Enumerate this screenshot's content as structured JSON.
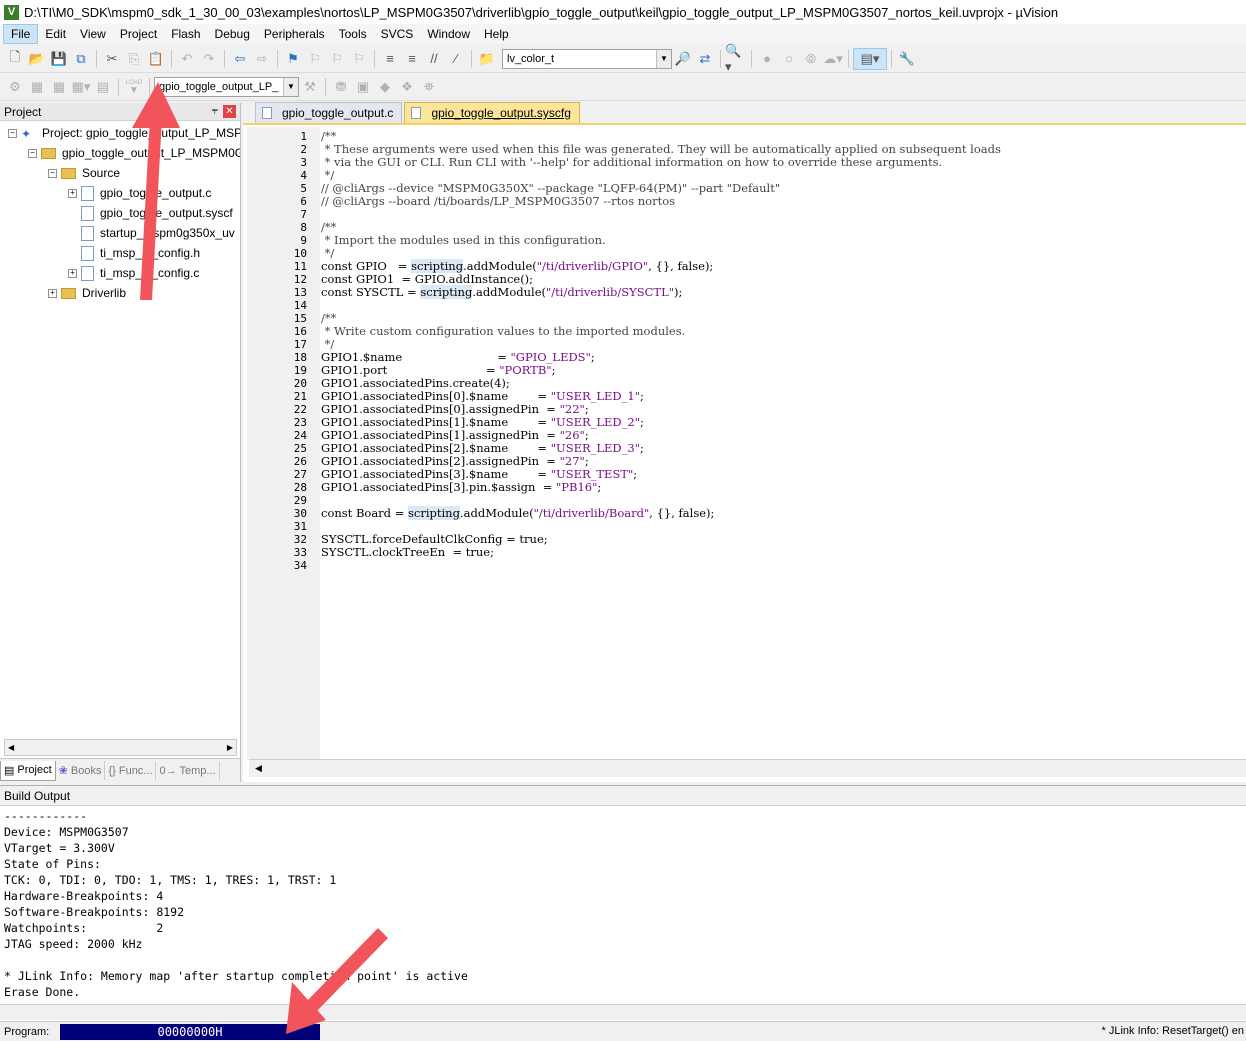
{
  "window": {
    "title": "D:\\TI\\M0_SDK\\mspm0_sdk_1_30_00_03\\examples\\nortos\\LP_MSPM0G3507\\driverlib\\gpio_toggle_output\\keil\\gpio_toggle_output_LP_MSPM0G3507_nortos_keil.uvprojx - µVision"
  },
  "menu": [
    "File",
    "Edit",
    "View",
    "Project",
    "Flash",
    "Debug",
    "Peripherals",
    "Tools",
    "SVCS",
    "Window",
    "Help"
  ],
  "toolbar": {
    "find_combo_value": "lv_color_t",
    "target_combo_value": "gpio_toggle_output_LP_",
    "load_icon_label": "LOAD"
  },
  "project_panel": {
    "title": "Project",
    "tree": [
      {
        "label": "Project: gpio_toggle_output_LP_MSP",
        "icon": "project-icon"
      },
      {
        "label": "gpio_toggle_output_LP_MSPM0G",
        "icon": "target-icon"
      },
      {
        "label": "Source",
        "icon": "folder-icon"
      },
      {
        "label": "gpio_toggle_output.c",
        "icon": "file-icon"
      },
      {
        "label": "gpio_toggle_output.syscf",
        "icon": "file-icon"
      },
      {
        "label": "startup_mspm0g350x_uv",
        "icon": "file-icon"
      },
      {
        "label": "ti_msp_dl_config.h",
        "icon": "file-icon"
      },
      {
        "label": "ti_msp_dl_config.c",
        "icon": "file-icon"
      },
      {
        "label": "Driverlib",
        "icon": "folder-icon"
      }
    ],
    "tabs": [
      "Project",
      "Books",
      "{} Func...",
      "0→ Temp..."
    ]
  },
  "editor": {
    "tabs": [
      {
        "label": "gpio_toggle_output.c",
        "active": false
      },
      {
        "label": "gpio_toggle_output.syscfg",
        "active": true
      }
    ],
    "lines": [
      "/**",
      " * These arguments were used when this file was generated. They will be automatically applied on subsequent loads",
      " * via the GUI or CLI. Run CLI with '--help' for additional information on how to override these arguments.",
      " */",
      "// @cliArgs --device \"MSPM0G350X\" --package \"LQFP-64(PM)\" --part \"Default\"",
      "// @cliArgs --board /ti/boards/LP_MSPM0G3507 --rtos nortos",
      "",
      "/**",
      " * Import the modules used in this configuration.",
      " */",
      "const GPIO   = scripting.addModule(\"/ti/driverlib/GPIO\", {}, false);",
      "const GPIO1  = GPIO.addInstance();",
      "const SYSCTL = scripting.addModule(\"/ti/driverlib/SYSCTL\");",
      "",
      "/**",
      " * Write custom configuration values to the imported modules.",
      " */",
      "GPIO1.$name                          = \"GPIO_LEDS\";",
      "GPIO1.port                           = \"PORTB\";",
      "GPIO1.associatedPins.create(4);",
      "GPIO1.associatedPins[0].$name        = \"USER_LED_1\";",
      "GPIO1.associatedPins[0].assignedPin  = \"22\";",
      "GPIO1.associatedPins[1].$name        = \"USER_LED_2\";",
      "GPIO1.associatedPins[1].assignedPin  = \"26\";",
      "GPIO1.associatedPins[2].$name        = \"USER_LED_3\";",
      "GPIO1.associatedPins[2].assignedPin  = \"27\";",
      "GPIO1.associatedPins[3].$name        = \"USER_TEST\";",
      "GPIO1.associatedPins[3].pin.$assign  = \"PB16\";",
      "",
      "const Board = scripting.addModule(\"/ti/driverlib/Board\", {}, false);",
      "",
      "SYSCTL.forceDefaultClkConfig = true;",
      "SYSCTL.clockTreeEn  = true;",
      ""
    ]
  },
  "build_output": {
    "title": "Build Output",
    "lines": [
      "------------",
      "Device: MSPM0G3507",
      "VTarget = 3.300V",
      "State of Pins:",
      "TCK: 0, TDI: 0, TDO: 1, TMS: 1, TRES: 1, TRST: 1",
      "Hardware-Breakpoints: 4",
      "Software-Breakpoints: 8192",
      "Watchpoints:          2",
      "JTAG speed: 2000 kHz",
      "",
      "* JLink Info: Memory map 'after startup completion point' is active",
      "Erase Done."
    ]
  },
  "status": {
    "program_label": "Program:",
    "program_value": "00000000H",
    "right_text": "* JLink Info: ResetTarget() en"
  },
  "colors": {
    "progress": "#00007a",
    "active_tab": "#fbe59a",
    "annotation_arrow": "#f2545b"
  }
}
